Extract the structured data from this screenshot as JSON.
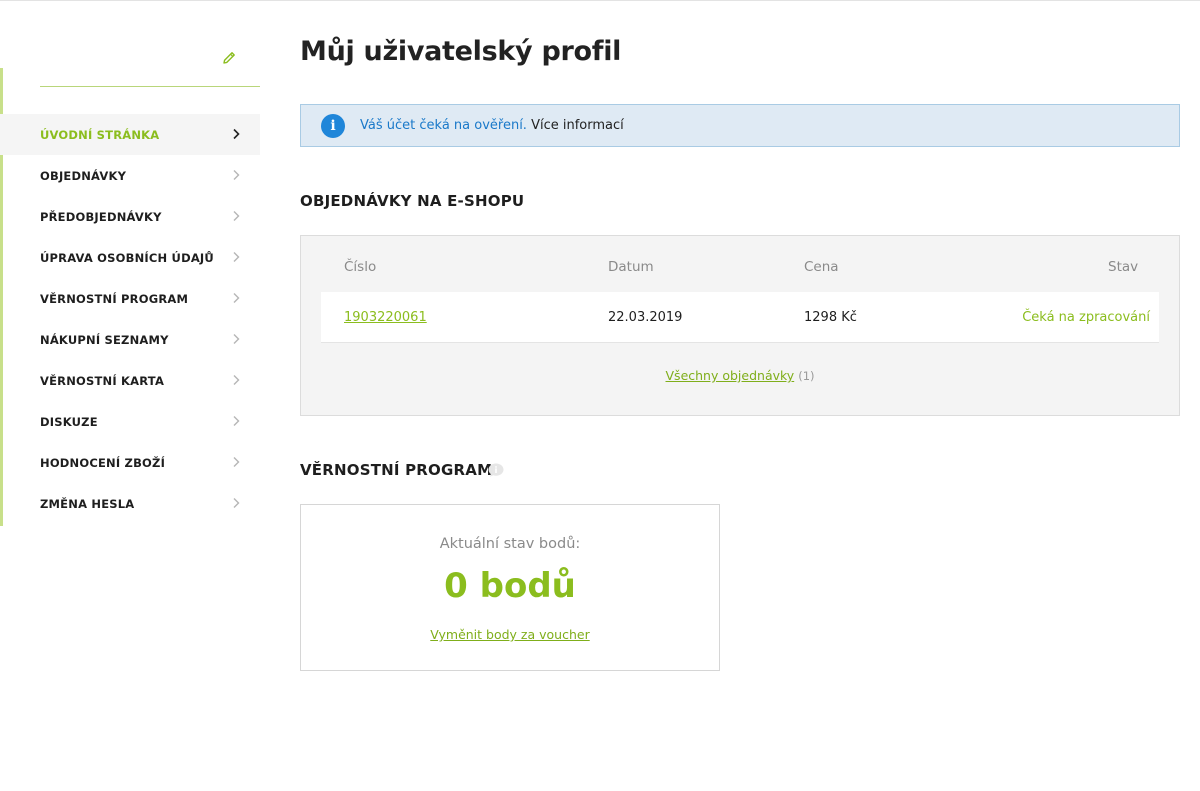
{
  "sidebar": {
    "items": [
      {
        "label": "ÚVODNÍ STRÁNKA",
        "active": true
      },
      {
        "label": "OBJEDNÁVKY"
      },
      {
        "label": "PŘEDOBJEDNÁVKY"
      },
      {
        "label": "ÚPRAVA OSOBNÍCH ÚDAJŮ"
      },
      {
        "label": "VĚRNOSTNÍ PROGRAM"
      },
      {
        "label": "NÁKUPNÍ SEZNAMY"
      },
      {
        "label": "VĚRNOSTNÍ KARTA"
      },
      {
        "label": "DISKUZE"
      },
      {
        "label": "HODNOCENÍ ZBOŽÍ"
      },
      {
        "label": "ZMĚNA HESLA"
      }
    ],
    "edit_icon": "pencil-icon"
  },
  "page": {
    "title": "Můj uživatelský profil"
  },
  "info_banner": {
    "icon": "info-icon",
    "icon_glyph": "i",
    "status_text": "Váš účet čeká na ověření.",
    "link_text": "Více informací"
  },
  "orders": {
    "title": "OBJEDNÁVKY NA E-SHOPU",
    "columns": [
      "Číslo",
      "Datum",
      "Cena",
      "Stav"
    ],
    "rows": [
      {
        "number": "1903220061",
        "date": "22.03.2019",
        "price": "1298 Kč",
        "status": "Čeká na zpracování"
      }
    ],
    "all_link": "Všechny objednávky",
    "all_count": "(1)"
  },
  "loyalty": {
    "title": "VĚRNOSTNÍ PROGRAM",
    "info_icon": "info-bubble-icon",
    "points_label": "Aktuální stav bodů:",
    "points_value": "0 bodů",
    "exchange_link": "Vyměnit body za voucher"
  },
  "colors": {
    "accent_green": "#8bbd1e",
    "info_blue": "#1f86d9",
    "info_bg": "#dfeaf4"
  }
}
